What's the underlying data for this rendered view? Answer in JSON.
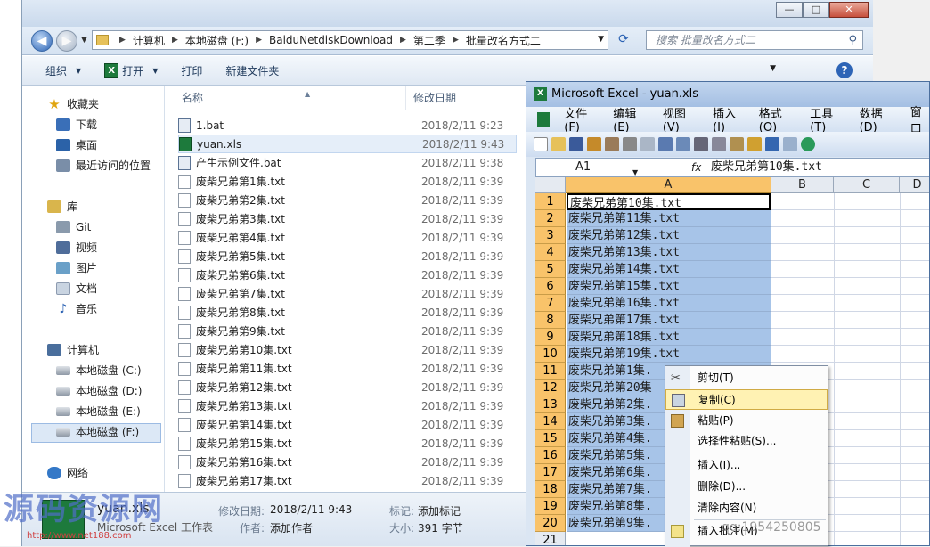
{
  "explorer": {
    "window_buttons": [
      "—",
      "□",
      "✕"
    ],
    "breadcrumbs": [
      "计算机",
      "本地磁盘 (F:)",
      "BaiduNetdiskDownload",
      "第二季",
      "批量改名方式二"
    ],
    "search_placeholder": "搜索 批量改名方式二",
    "toolbar": {
      "organize": "组织",
      "open": "打开",
      "print": "打印",
      "new_folder": "新建文件夹"
    },
    "nav": {
      "favorites": "收藏夹",
      "downloads": "下载",
      "desktop": "桌面",
      "recent": "最近访问的位置",
      "libraries": "库",
      "git": "Git",
      "videos": "视频",
      "pictures": "图片",
      "documents": "文档",
      "music": "音乐",
      "computer": "计算机",
      "drive_c": "本地磁盘 (C:)",
      "drive_d": "本地磁盘 (D:)",
      "drive_e": "本地磁盘 (E:)",
      "drive_f": "本地磁盘 (F:)",
      "network": "网络"
    },
    "columns": {
      "name": "名称",
      "date": "修改日期"
    },
    "files": [
      {
        "name": "1.bat",
        "date": "2018/2/11 9:23",
        "type": "W"
      },
      {
        "name": "yuan.xls",
        "date": "2018/2/11 9:43",
        "type": "M"
      },
      {
        "name": "产生示例文件.bat",
        "date": "2018/2/11 9:38",
        "type": "W"
      },
      {
        "name": "废柴兄弟第1集.txt",
        "date": "2018/2/11 9:39",
        "type": "文"
      },
      {
        "name": "废柴兄弟第2集.txt",
        "date": "2018/2/11 9:39",
        "type": "文"
      },
      {
        "name": "废柴兄弟第3集.txt",
        "date": "2018/2/11 9:39",
        "type": "文"
      },
      {
        "name": "废柴兄弟第4集.txt",
        "date": "2018/2/11 9:39",
        "type": "文"
      },
      {
        "name": "废柴兄弟第5集.txt",
        "date": "2018/2/11 9:39",
        "type": "文"
      },
      {
        "name": "废柴兄弟第6集.txt",
        "date": "2018/2/11 9:39",
        "type": "文"
      },
      {
        "name": "废柴兄弟第7集.txt",
        "date": "2018/2/11 9:39",
        "type": "文"
      },
      {
        "name": "废柴兄弟第8集.txt",
        "date": "2018/2/11 9:39",
        "type": "文"
      },
      {
        "name": "废柴兄弟第9集.txt",
        "date": "2018/2/11 9:39",
        "type": "文"
      },
      {
        "name": "废柴兄弟第10集.txt",
        "date": "2018/2/11 9:39",
        "type": "文"
      },
      {
        "name": "废柴兄弟第11集.txt",
        "date": "2018/2/11 9:39",
        "type": "文"
      },
      {
        "name": "废柴兄弟第12集.txt",
        "date": "2018/2/11 9:39",
        "type": "文"
      },
      {
        "name": "废柴兄弟第13集.txt",
        "date": "2018/2/11 9:39",
        "type": "文"
      },
      {
        "name": "废柴兄弟第14集.txt",
        "date": "2018/2/11 9:39",
        "type": "文"
      },
      {
        "name": "废柴兄弟第15集.txt",
        "date": "2018/2/11 9:39",
        "type": "文"
      },
      {
        "name": "废柴兄弟第16集.txt",
        "date": "2018/2/11 9:39",
        "type": "文"
      },
      {
        "name": "废柴兄弟第17集.txt",
        "date": "2018/2/11 9:39",
        "type": "文"
      }
    ],
    "details": {
      "name": "yuan.xls",
      "type": "Microsoft Excel 工作表",
      "modified_label": "修改日期:",
      "modified_value": "2018/2/11 9:43",
      "tags_label": "标记:",
      "tags_value": "添加标记",
      "author_label": "作者:",
      "author_value": "添加作者",
      "size_label": "大小:",
      "size_value": "391 字节"
    }
  },
  "excel": {
    "title": "Microsoft Excel - yuan.xls",
    "menu": [
      "文件(F)",
      "编辑(E)",
      "视图(V)",
      "插入(I)",
      "格式(O)",
      "工具(T)",
      "数据(D)",
      "窗口"
    ],
    "name_box": "A1",
    "fx": "fx",
    "formula": "废柴兄弟第10集.txt",
    "columns": [
      "A",
      "B",
      "C",
      "D"
    ],
    "rows": [
      "1",
      "2",
      "3",
      "4",
      "5",
      "6",
      "7",
      "8",
      "9",
      "10",
      "11",
      "12",
      "13",
      "14",
      "15",
      "16",
      "17",
      "18",
      "19",
      "20",
      "21"
    ],
    "cells": [
      "废柴兄弟第10集.txt",
      "废柴兄弟第11集.txt",
      "废柴兄弟第12集.txt",
      "废柴兄弟第13集.txt",
      "废柴兄弟第14集.txt",
      "废柴兄弟第15集.txt",
      "废柴兄弟第16集.txt",
      "废柴兄弟第17集.txt",
      "废柴兄弟第18集.txt",
      "废柴兄弟第19集.txt",
      "废柴兄弟第1集.",
      "废柴兄弟第20集",
      "废柴兄弟第2集.",
      "废柴兄弟第3集.",
      "废柴兄弟第4集.",
      "废柴兄弟第5集.",
      "废柴兄弟第6集.",
      "废柴兄弟第7集.",
      "废柴兄弟第8集.",
      "废柴兄弟第9集."
    ]
  },
  "context_menu": {
    "items": [
      "剪切(T)",
      "复制(C)",
      "粘贴(P)",
      "选择性粘贴(S)...",
      "插入(I)...",
      "删除(D)...",
      "清除内容(N)",
      "插入批注(M)"
    ],
    "highlighted": "复制(C)"
  },
  "watermark": {
    "text": "源码资源网",
    "url": "http://www.net188.com",
    "qq": "qq:1954250805"
  }
}
